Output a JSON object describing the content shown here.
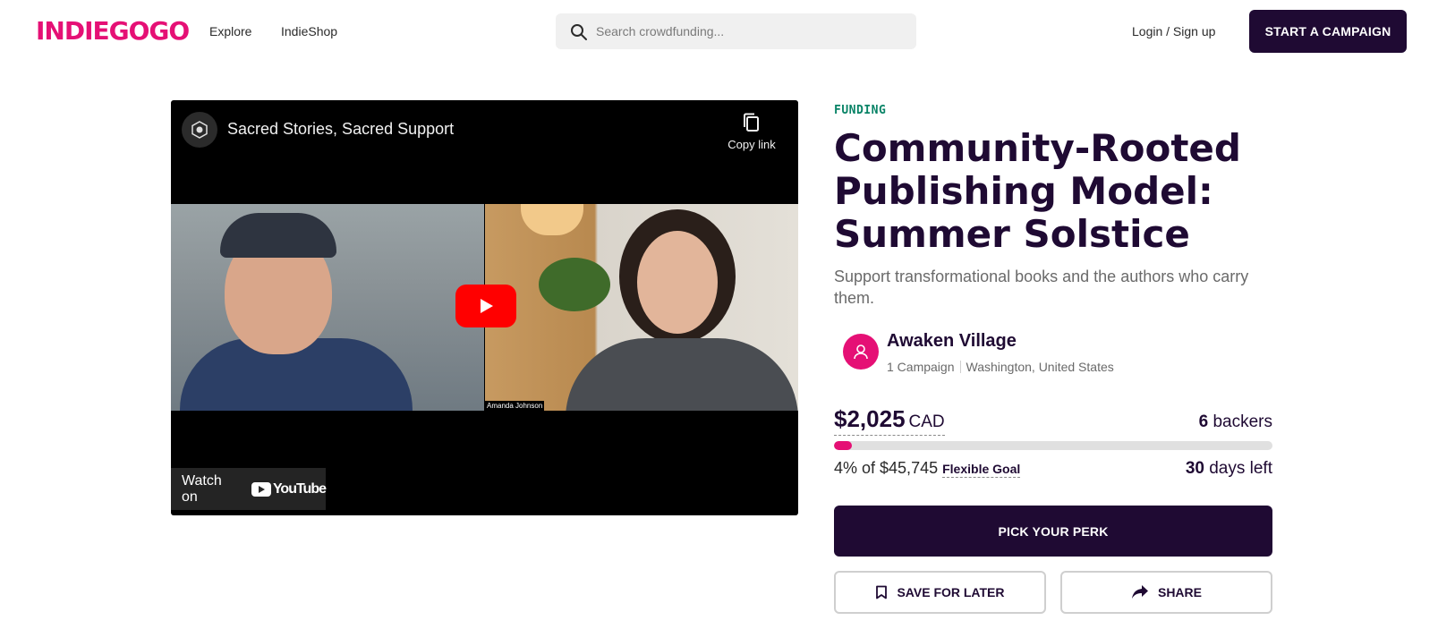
{
  "header": {
    "logo": "INDIEGOGO",
    "nav": [
      "Explore",
      "IndieShop"
    ],
    "search_placeholder": "Search crowdfunding...",
    "login_label": "Login / Sign up",
    "start_campaign_label": "START A CAMPAIGN"
  },
  "video": {
    "title": "Sacred Stories, Sacred Support",
    "copy_link_label": "Copy link",
    "name_tag": "Amanda Johnson",
    "watch_on_label": "Watch on",
    "youtube_label": "YouTube"
  },
  "campaign": {
    "tag": "FUNDING",
    "title": "Community-Rooted Publishing Model: Summer Solstice",
    "subtitle": "Support transformational books and the authors who carry them.",
    "owner": {
      "name": "Awaken Village",
      "campaigns": "1 Campaign",
      "location": "Washington, United States"
    },
    "raised_amount": "$2,025",
    "currency": "CAD",
    "backers_count": "6",
    "backers_label": "backers",
    "progress_percent": 4,
    "percent_text": "4% of $45,745",
    "goal_type": "Flexible Goal",
    "days_count": "30",
    "days_label": "days left"
  },
  "actions": {
    "pick_perk": "PICK YOUR PERK",
    "save": "SAVE FOR LATER",
    "share": "SHARE"
  },
  "colors": {
    "brand": "#e51075",
    "dark": "#1f0a33",
    "funding": "#088366"
  }
}
